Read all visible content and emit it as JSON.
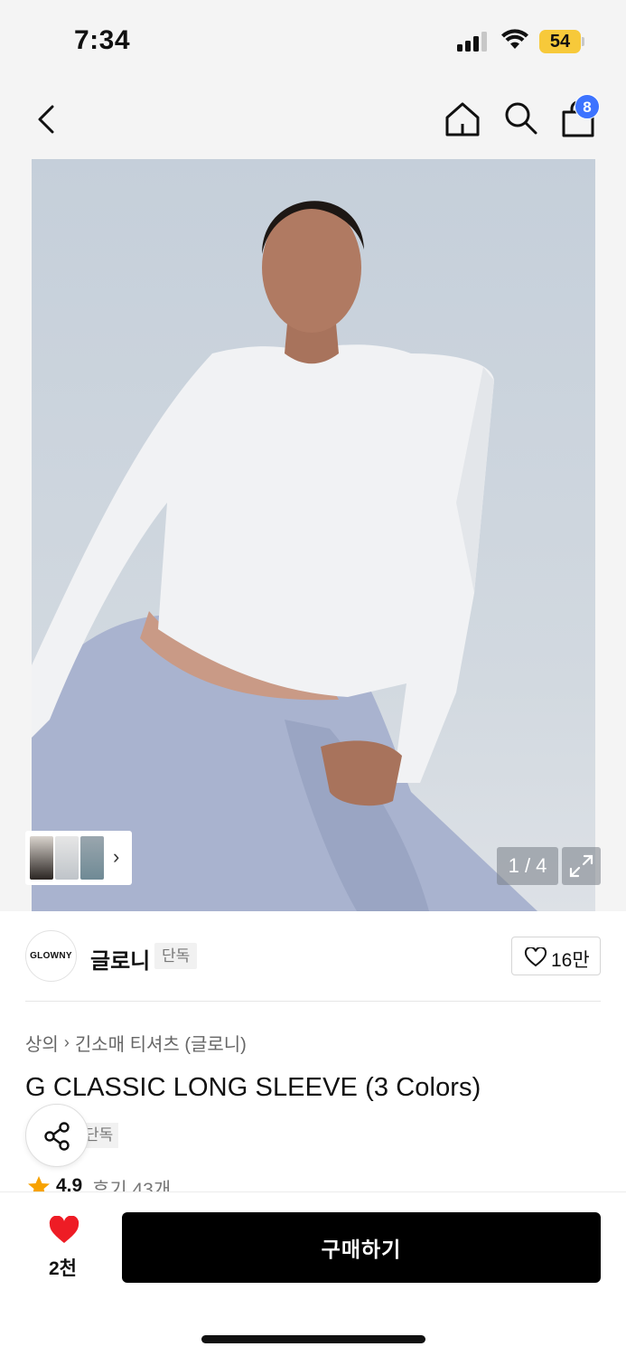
{
  "status_bar": {
    "time": "7:34",
    "battery": "54"
  },
  "nav": {
    "cart_count": "8"
  },
  "gallery": {
    "counter": "1 / 4"
  },
  "brand": {
    "logo_text": "GLOWNY",
    "name": "글로니",
    "tag": "단독",
    "likes": "16만"
  },
  "category": {
    "level1": "상의",
    "level2": "긴소매 티셔츠 (글로니)"
  },
  "product": {
    "title": "G CLASSIC LONG SLEEVE (3 Colors)",
    "exclusive_tag": "단독",
    "rating": "4.9",
    "reviews": "후기 43개"
  },
  "bottom": {
    "wish_count": "2천",
    "buy_label": "구매하기"
  },
  "colors": {
    "accent_blue": "#3d73ff",
    "heart_red": "#ee1c25",
    "star_orange": "#f7a200",
    "battery_yellow": "#f7c93a"
  }
}
